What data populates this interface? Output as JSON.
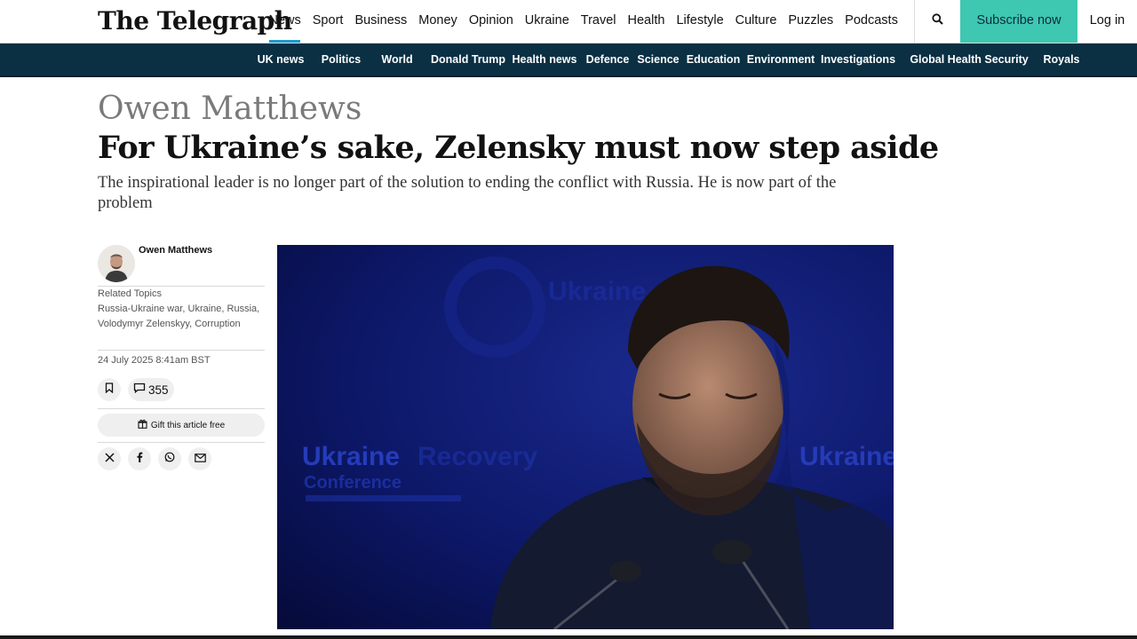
{
  "header": {
    "logo": "The Telegraph",
    "nav": [
      "News",
      "Sport",
      "Business",
      "Money",
      "Opinion",
      "Ukraine",
      "Travel",
      "Health",
      "Lifestyle",
      "Culture",
      "Puzzles",
      "Podcasts"
    ],
    "active_nav": "News",
    "search_icon": "search-icon",
    "subscribe_label": "Subscribe now",
    "login_label": "Log in"
  },
  "subnav": {
    "items": [
      "UK news",
      "Politics",
      "World",
      "Donald Trump",
      "Health news",
      "Defence",
      "Science",
      "Education",
      "Environment",
      "Investigations",
      "Global Health Security",
      "Royals"
    ]
  },
  "article": {
    "kicker": "Owen Matthews",
    "headline": "For Ukraine’s sake, Zelensky must now step aside",
    "standfirst": "The inspirational leader is no longer part of the solution to ending the conflict with Russia. He is now part of the problem"
  },
  "sidebar": {
    "author": "Owen Matthews",
    "related_heading": "Related Topics",
    "topics": [
      "Russia-Ukraine war",
      "Ukraine",
      "Russia",
      "Volodymyr Zelenskyy",
      "Corruption"
    ],
    "timestamp": "24 July 2025 8:41am BST",
    "comments_count": "355",
    "gift_label": "Gift this article free",
    "share_icons": [
      "x-icon",
      "facebook-icon",
      "whatsapp-icon",
      "email-icon"
    ]
  },
  "image": {
    "backdrop_text_top": "Ukraine",
    "backdrop_text_mid_a": "Ukraine",
    "backdrop_text_mid_b": "Recovery",
    "backdrop_text_conf": "Conference",
    "backdrop_text_right": "Ukraine"
  },
  "colors": {
    "accent_blue": "#1c9bd1",
    "subscribe_teal": "#3ec7b1",
    "subnav_navy": "#0b3043",
    "image_backdrop": "#0b1560"
  }
}
